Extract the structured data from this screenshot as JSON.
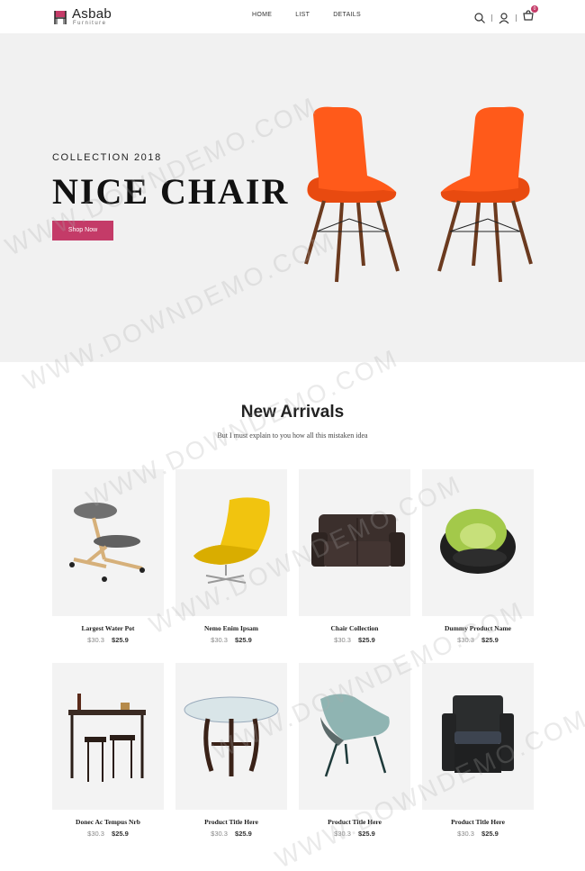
{
  "brand": {
    "name": "Asbab",
    "tagline": "Furniture"
  },
  "nav": [
    {
      "label": "HOME"
    },
    {
      "label": "LIST"
    },
    {
      "label": "DETAILS"
    }
  ],
  "header_icons": {
    "search": "search-icon",
    "user": "user-icon",
    "cart": "cart-icon",
    "cart_count": "0"
  },
  "hero": {
    "subtitle": "COLLECTION 2018",
    "title": "NICE CHAIR",
    "button": "Shop Now"
  },
  "section": {
    "title": "New Arrivals",
    "subtitle": "But I must explain to you how all this mistaken idea"
  },
  "products": [
    {
      "name": "Largest Water Pot",
      "old_price": "$30.3",
      "price": "$25.9",
      "image": "kneeling-chair"
    },
    {
      "name": "Nemo Enim Ipsam",
      "old_price": "$30.3",
      "price": "$25.9",
      "image": "yellow-lounge-chair"
    },
    {
      "name": "Chair Collection",
      "old_price": "$30.3",
      "price": "$25.9",
      "image": "leather-sofa"
    },
    {
      "name": "Dummy Product Name",
      "old_price": "$30.3",
      "price": "$25.9",
      "image": "green-pod-chair"
    },
    {
      "name": "Donec Ac Tempus Nrb",
      "old_price": "$30.3",
      "price": "$25.9",
      "image": "bar-table-set"
    },
    {
      "name": "Product Title Here",
      "old_price": "$30.3",
      "price": "$25.9",
      "image": "glass-table"
    },
    {
      "name": "Product Title Here",
      "old_price": "$30.3",
      "price": "$25.9",
      "image": "teal-shell-chair"
    },
    {
      "name": "Product Title Here",
      "old_price": "$30.3",
      "price": "$25.9",
      "image": "wicker-armchair"
    }
  ],
  "watermark": "WWW.DOWNDEMO.COM",
  "colors": {
    "accent": "#c43b68",
    "hero_bg": "#f1f1f1",
    "card_bg": "#f3f3f3",
    "chair_orange": "#ff5a1a"
  }
}
